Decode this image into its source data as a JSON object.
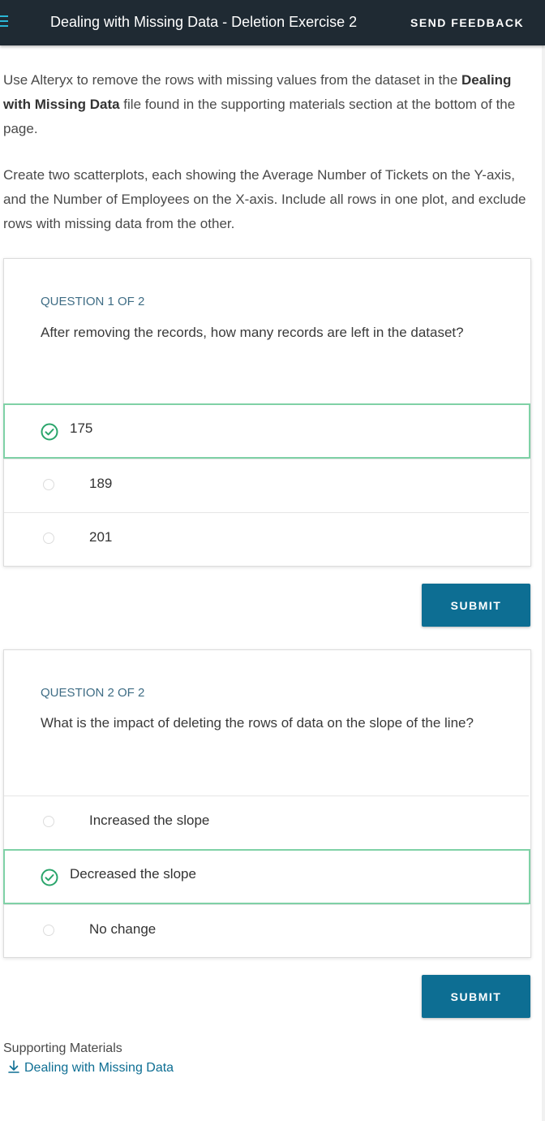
{
  "header": {
    "title": "Dealing with Missing Data - Deletion Exercise 2",
    "feedback_label": "SEND FEEDBACK"
  },
  "intro": {
    "p1_before": "Use Alteryx to remove the rows with missing values from the dataset in the ",
    "p1_bold": "Dealing with Missing Data",
    "p1_after": " file found in the supporting materials section at the bottom of the page.",
    "p2": "Create two scatterplots, each showing the Average Number of Tickets on the Y-axis, and the Number of Employees on the X-axis. Include all rows in one plot, and exclude rows with missing data from the other."
  },
  "questions": [
    {
      "number_label": "QUESTION 1 OF 2",
      "text": "After removing the records, how many records are left in the dataset?",
      "options": [
        {
          "label": "175",
          "selected": true
        },
        {
          "label": "189",
          "selected": false
        },
        {
          "label": "201",
          "selected": false
        }
      ],
      "submit_label": "SUBMIT"
    },
    {
      "number_label": "QUESTION 2 OF 2",
      "text": "What is the impact of deleting the rows of data on the slope of the line?",
      "options": [
        {
          "label": "Increased the slope",
          "selected": false
        },
        {
          "label": "Decreased the slope",
          "selected": true
        },
        {
          "label": "No change",
          "selected": false
        }
      ],
      "submit_label": "SUBMIT"
    }
  ],
  "supporting": {
    "title": "Supporting Materials",
    "link_label": "Dealing with Missing Data"
  },
  "colors": {
    "topbar": "#1f2a33",
    "accent": "#0d6e93",
    "selected_border": "#7fd1a6",
    "check_green": "#2aa56b",
    "question_number": "#3f6d85"
  },
  "icons": [
    "menu-icon",
    "check-circle-icon",
    "radio-icon",
    "download-arrow-icon"
  ]
}
